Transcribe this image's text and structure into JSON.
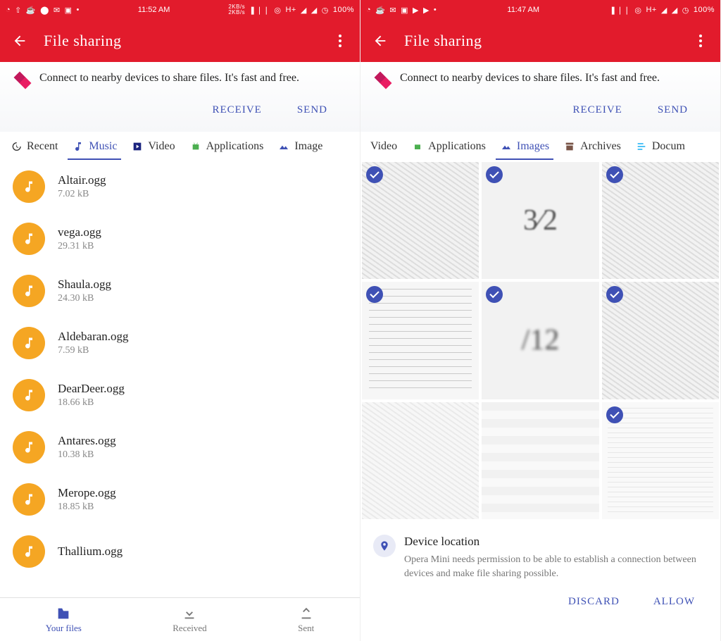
{
  "left": {
    "statusbar": {
      "time": "11:52 AM",
      "net": "2KB/s",
      "net2": "2KB/s",
      "h": "H+",
      "battery": "100%"
    },
    "appbar": {
      "title": "File sharing"
    },
    "banner": {
      "text": "Connect to nearby devices to share files. It's fast and free.",
      "receive": "RECEIVE",
      "send": "SEND"
    },
    "tabs": [
      {
        "label": "Recent",
        "key": "recent",
        "active": false
      },
      {
        "label": "Music",
        "key": "music",
        "active": true
      },
      {
        "label": "Video",
        "key": "video",
        "active": false
      },
      {
        "label": "Applications",
        "key": "apps",
        "active": false
      },
      {
        "label": "Image",
        "key": "images",
        "active": false
      }
    ],
    "files": [
      {
        "name": "Altair.ogg",
        "size": "7.02 kB"
      },
      {
        "name": "vega.ogg",
        "size": "29.31 kB"
      },
      {
        "name": "Shaula.ogg",
        "size": "24.30 kB"
      },
      {
        "name": "Aldebaran.ogg",
        "size": "7.59 kB"
      },
      {
        "name": "DearDeer.ogg",
        "size": "18.66 kB"
      },
      {
        "name": "Antares.ogg",
        "size": "10.38 kB"
      },
      {
        "name": "Merope.ogg",
        "size": "18.85 kB"
      },
      {
        "name": "Thallium.ogg",
        "size": ""
      }
    ],
    "bottomnav": {
      "yourfiles": "Your files",
      "received": "Received",
      "sent": "Sent"
    }
  },
  "right": {
    "statusbar": {
      "time": "11:47 AM",
      "h": "H+",
      "battery": "100%"
    },
    "appbar": {
      "title": "File sharing"
    },
    "banner": {
      "text": "Connect to nearby devices to share files. It's fast and free.",
      "receive": "RECEIVE",
      "send": "SEND"
    },
    "tabs": [
      {
        "label": "Video",
        "key": "video",
        "active": false
      },
      {
        "label": "Applications",
        "key": "apps",
        "active": false
      },
      {
        "label": "Images",
        "key": "images",
        "active": true
      },
      {
        "label": "Archives",
        "key": "archives",
        "active": false
      },
      {
        "label": "Docum",
        "key": "documents",
        "active": false
      }
    ],
    "thumbs": [
      {
        "selected": true,
        "label": "sketch"
      },
      {
        "selected": true,
        "label": "3/2"
      },
      {
        "selected": true,
        "label": "sketch"
      },
      {
        "selected": true,
        "label": "page"
      },
      {
        "selected": true,
        "label": "/12"
      },
      {
        "selected": true,
        "label": "sketch"
      },
      {
        "selected": false,
        "label": "sketch",
        "dim": true
      },
      {
        "selected": false,
        "label": "table",
        "dim": true
      },
      {
        "selected": true,
        "label": "page",
        "dim": true
      }
    ],
    "perm": {
      "title": "Device location",
      "body": "Opera Mini needs permission to be able to establish a connection between devices and make file sharing possible.",
      "discard": "DISCARD",
      "allow": "ALLOW"
    }
  }
}
